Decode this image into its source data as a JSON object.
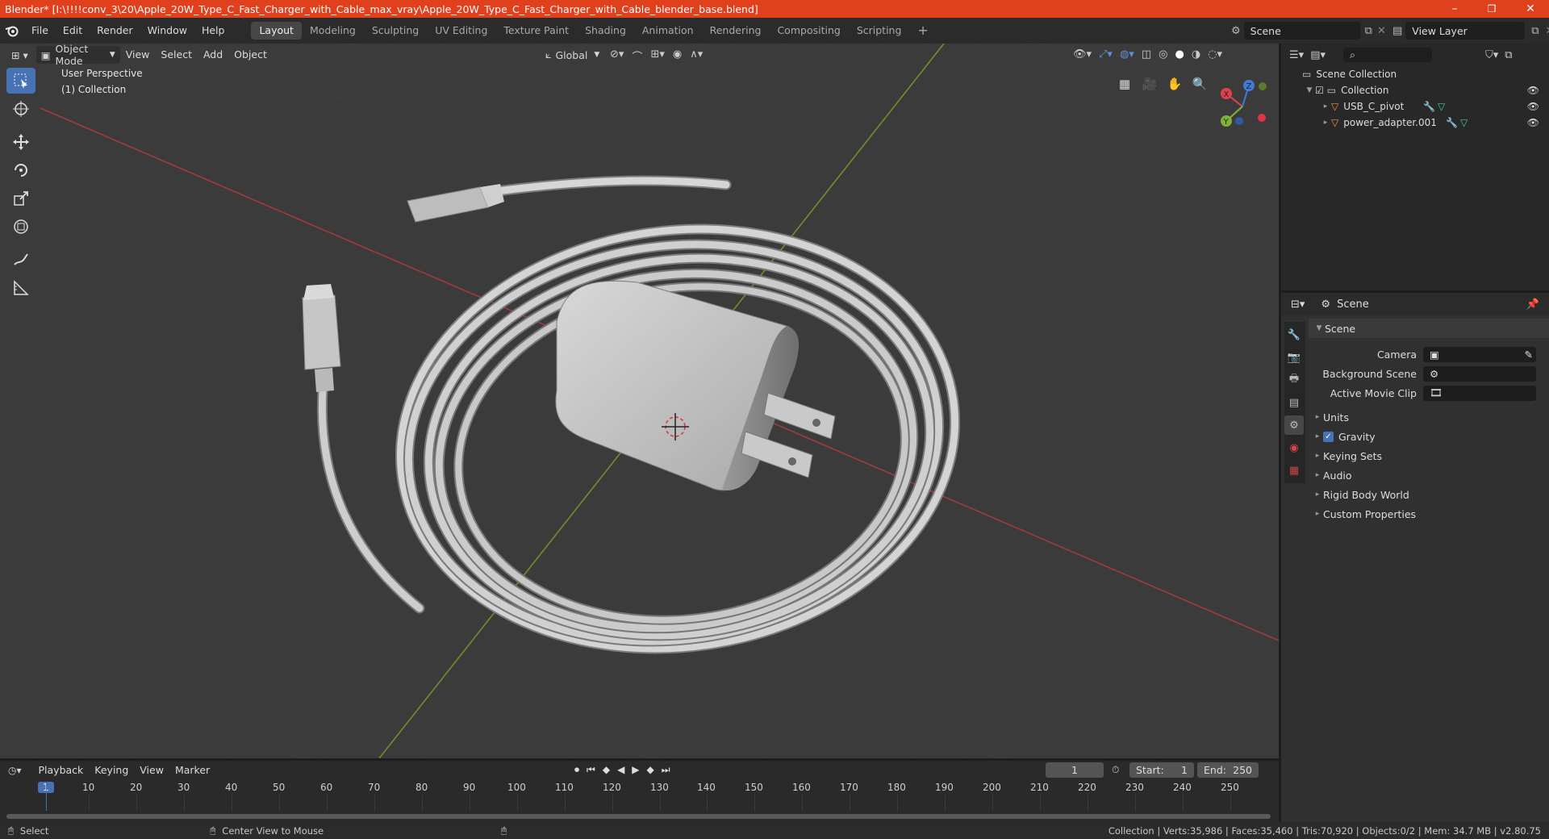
{
  "window": {
    "title": "Blender* [I:\\!!!!conv_3\\20\\Apple_20W_Type_C_Fast_Charger_with_Cable_max_vray\\Apple_20W_Type_C_Fast_Charger_with_Cable_blender_base.blend]",
    "minimize": "–",
    "maximize": "❐",
    "close": "✕"
  },
  "menu": [
    "File",
    "Edit",
    "Render",
    "Window",
    "Help"
  ],
  "workspaces": [
    "Layout",
    "Modeling",
    "Sculpting",
    "UV Editing",
    "Texture Paint",
    "Shading",
    "Animation",
    "Rendering",
    "Compositing",
    "Scripting"
  ],
  "workspace_add": "+",
  "scene_selector": {
    "value": "Scene"
  },
  "view_layer_selector": {
    "value": "View Layer"
  },
  "viewport": {
    "mode": "Object Mode",
    "menus": [
      "View",
      "Select",
      "Add",
      "Object"
    ],
    "transform_orientation": "Global",
    "overlay_line1": "User Perspective",
    "overlay_line2": "(1) Collection",
    "gizmo_axes": {
      "x": "X",
      "y": "Y",
      "z": "Z"
    }
  },
  "outliner": {
    "search_placeholder": "",
    "root": "Scene Collection",
    "collection": "Collection",
    "items": [
      "USB_C_pivot",
      "power_adapter.001"
    ]
  },
  "properties": {
    "header": "Scene",
    "panel_title": "Scene",
    "fields": [
      {
        "label": "Camera",
        "value": ""
      },
      {
        "label": "Background Scene",
        "value": ""
      },
      {
        "label": "Active Movie Clip",
        "value": ""
      }
    ],
    "sections": [
      "Units",
      "Gravity",
      "Keying Sets",
      "Audio",
      "Rigid Body World",
      "Custom Properties"
    ]
  },
  "timeline": {
    "menus": [
      "Playback",
      "Keying",
      "View",
      "Marker"
    ],
    "current_frame": "1",
    "start_label": "Start:",
    "start_value": "1",
    "end_label": "End:",
    "end_value": "250",
    "ticks": [
      "1",
      "10",
      "20",
      "30",
      "40",
      "50",
      "60",
      "70",
      "80",
      "90",
      "100",
      "110",
      "120",
      "130",
      "140",
      "150",
      "160",
      "170",
      "180",
      "190",
      "200",
      "210",
      "220",
      "230",
      "240",
      "250"
    ]
  },
  "statusbar": {
    "left_action": "Select",
    "mid_action": "Center View to Mouse",
    "stats": "Collection | Verts:35,986 | Faces:35,460 | Tris:70,920 | Objects:0/2 | Mem: 34.7 MB | v2.80.75"
  },
  "colors": {
    "titlebar": "#e1401c",
    "accent": "#4772b3",
    "axis_x": "#e2404f",
    "axis_y": "#7fb33a",
    "axis_z": "#3f7cd9"
  }
}
